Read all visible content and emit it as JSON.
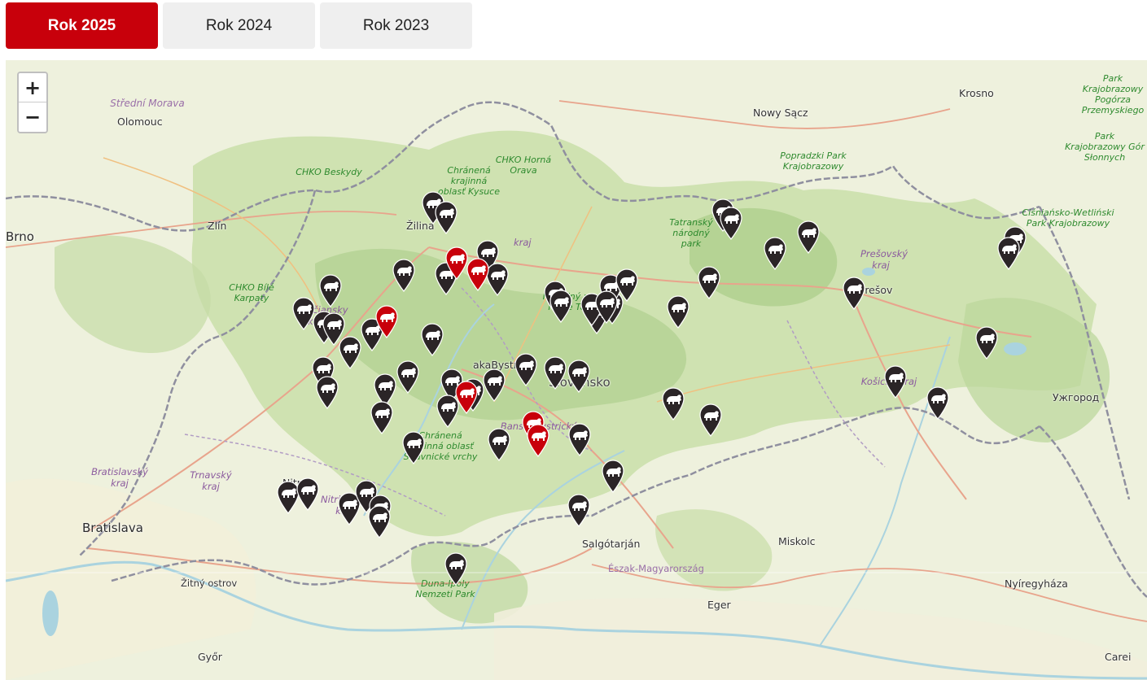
{
  "tabs": [
    {
      "label": "Rok 2025",
      "active": true
    },
    {
      "label": "Rok 2024",
      "active": false
    },
    {
      "label": "Rok 2023",
      "active": false
    }
  ],
  "zoom": {
    "in_label": "+",
    "out_label": "−"
  },
  "colors": {
    "active_tab": "#c8000b",
    "marker_dark": "#2b2527",
    "marker_red": "#c8000b",
    "forest": "#b9d59a",
    "water": "#aad3df",
    "border": "#8f8f9f"
  },
  "map_labels": {
    "cities": {
      "brno": "Brno",
      "olomouc": "Olomouc",
      "zlin": "Zlín",
      "zilina": "Žilina",
      "trencin": "Trenčiansky kraj",
      "nitra": "Nitra",
      "bratislava": "Bratislava",
      "nowy_sacz": "Nowy Sącz",
      "krosno": "Krosno",
      "presov": "Prešov",
      "uzhorod": "Ужгород",
      "salgotarjan": "Salgótarján",
      "eger": "Eger",
      "miskolc": "Miskolc",
      "nyiregyhaza": "Nyíregyháza",
      "gyor": "Győr",
      "carei": "Carei",
      "zitny_ostrov": "Žitný ostrov",
      "bystrica": "akaBystrica"
    },
    "country": "Slovensko",
    "parks": {
      "stredni_morava": "Střední Morava",
      "beskydy": "CHKO Beskydy",
      "kysuce": "Chránená krajinná oblasť Kysuce",
      "orava": "CHKO Horná Orava",
      "tatry": "Tatranský národný park",
      "popradzki": "Popradzki Park Krajobrazowy",
      "bile_karpaty": "CHKO Bílé Karpaty",
      "nizke_tatry": "Národný park Nízke Tatry",
      "stiavnicke": "Chránená krajinná oblasť Štiavnické vrchy",
      "duna_ipoly": "Duna-Ipoly Nemzeti Park",
      "przemyski": "Park Krajobrazowy Pogórza Przemyskiego",
      "gor_slonnych": "Park Krajobrazowy Gór Słonnych",
      "cisniansko": "Ciśniańsko-Wetliński Park Krajobrazowy"
    },
    "regions": {
      "bratislavsky": "Bratislavský kraj",
      "trnavsky": "Trnavský kraj",
      "nitriansky": "Nitriansky kraj",
      "banskobystricky": "Banskobystrický kraj",
      "kosicky": "Košický kraj",
      "presovsky": "Prešovský kraj",
      "zilinsky": "kraj",
      "eszak": "Észak-Magyarország"
    }
  },
  "markers": {
    "dark": [
      "dark",
      "dark",
      "dark",
      "dark",
      "dark",
      "dark",
      "dark",
      "dark",
      "dark",
      "dark",
      "dark",
      "dark",
      "dark",
      "dark",
      "dark",
      "dark",
      "dark",
      "dark",
      "dark",
      "dark",
      "dark",
      "dark",
      "dark",
      "dark",
      "dark",
      "dark",
      "dark",
      "dark",
      "dark",
      "dark",
      "dark",
      "dark",
      "dark",
      "dark",
      "dark",
      "dark",
      "dark",
      "dark",
      "dark",
      "dark",
      "dark",
      "dark",
      "dark",
      "dark",
      "dark",
      "dark",
      "dark",
      "dark",
      "dark",
      "dark",
      "dark",
      "dark",
      "dark",
      "dark",
      "dark",
      "dark",
      "dark",
      "dark",
      "dark"
    ],
    "red_count": 6,
    "dark_count": 59,
    "icon": "bear-icon"
  }
}
